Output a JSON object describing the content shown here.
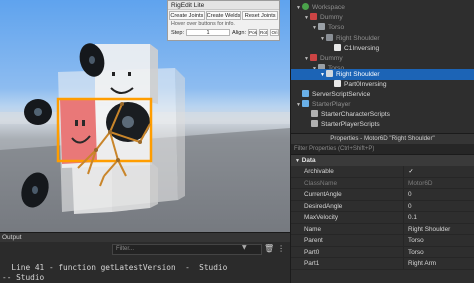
{
  "rigedit": {
    "title": "RigEdit Lite",
    "buttons": [
      "Create Joints",
      "Create Welds",
      "Reset Joints"
    ],
    "hint": "Hover over buttons for info.",
    "step_label": "Step:",
    "step_value": "1",
    "align_label": "Align:",
    "align_axes": [
      "Pos",
      "Rot",
      "Ori"
    ]
  },
  "output": {
    "title": "Output",
    "filter_placeholder": "Filter...",
    "lines": [
      "  Line 41 - function getLatestVersion  -  Studio",
      "-- Studio"
    ]
  },
  "explorer": {
    "items": [
      {
        "label": "Workspace",
        "arrow": "▼",
        "dim": true
      },
      {
        "label": "Dummy",
        "arrow": "▼",
        "dim": true
      },
      {
        "label": "Torso",
        "arrow": "▼",
        "dim": true
      },
      {
        "label": "Right Shoulder",
        "arrow": "▼",
        "dim": true
      },
      {
        "label": "C1Inversing",
        "arrow": "",
        "dim": false
      },
      {
        "label": "Dummy",
        "arrow": "▼",
        "dim": true
      },
      {
        "label": "Torso",
        "arrow": "▼",
        "dim": true
      },
      {
        "label": "Right Shoulder",
        "arrow": "▼",
        "dim": false,
        "selected": true
      },
      {
        "label": "Part0Inversing",
        "arrow": "",
        "dim": false
      },
      {
        "label": "ServerScriptService",
        "arrow": "",
        "dim": false
      },
      {
        "label": "StarterPlayer",
        "arrow": "▼",
        "dim": true
      },
      {
        "label": "StarterCharacterScripts",
        "arrow": "",
        "dim": false
      },
      {
        "label": "StarterPlayerScripts",
        "arrow": "",
        "dim": false
      }
    ]
  },
  "properties": {
    "title": "Properties - Motor6D \"Right Shoulder\"",
    "filter_placeholder": "Filter Properties (Ctrl+Shift+P)",
    "section": "Data",
    "rows": [
      {
        "name": "Archivable",
        "value": "✓",
        "dim": false
      },
      {
        "name": "ClassName",
        "value": "Motor6D",
        "dim": true
      },
      {
        "name": "CurrentAngle",
        "value": "0",
        "dim": false
      },
      {
        "name": "DesiredAngle",
        "value": "0",
        "dim": false
      },
      {
        "name": "MaxVelocity",
        "value": "0.1",
        "dim": false
      },
      {
        "name": "Name",
        "value": "Right Shoulder",
        "dim": false
      },
      {
        "name": "Parent",
        "value": "Torso",
        "dim": false
      },
      {
        "name": "Part0",
        "value": "Torso",
        "dim": false
      },
      {
        "name": "Part1",
        "value": "Right Arm",
        "dim": false
      }
    ]
  },
  "colors": {
    "selection": "#1c64b6",
    "rig_highlight": "#ff9d00",
    "joint_line": "#c9852a"
  }
}
